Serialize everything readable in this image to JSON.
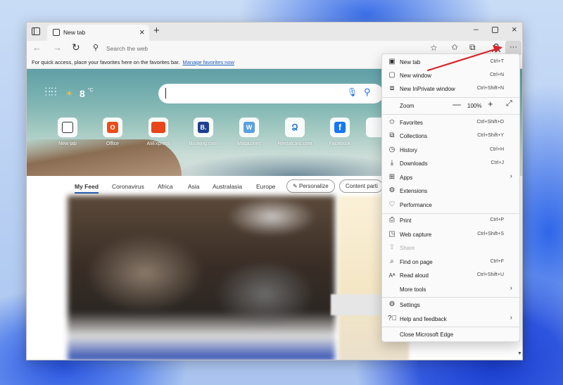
{
  "browser": {
    "tab_title": "New tab",
    "address_placeholder": "Search the web",
    "favorites_bar_message": "For quick access, place your favorites here on the favorites bar.",
    "favorites_bar_link": "Manage favorites now",
    "more_button_label": "···"
  },
  "ntp": {
    "weather_temp": "8",
    "weather_unit": "°C",
    "quick_links": [
      {
        "label": "New tab",
        "color": "#ffffff"
      },
      {
        "label": "Office",
        "color": "#e84e1b"
      },
      {
        "label": "AliExpress",
        "color": "#e8451a"
      },
      {
        "label": "Booking.com",
        "color": "#1e3f91"
      },
      {
        "label": "Magazines",
        "color": "#5aa0e0"
      },
      {
        "label": "Rentalcars.com",
        "color": "#1f74d4"
      },
      {
        "label": "Facebook",
        "color": "#1877f2"
      }
    ],
    "feed_tabs": [
      "My Feed",
      "Coronavirus",
      "Africa",
      "Asia",
      "Australasia",
      "Europe"
    ],
    "personalize_label": "Personalize",
    "content_partial_label": "Content parti"
  },
  "menu": {
    "items": [
      {
        "label": "New tab",
        "shortcut": "Ctrl+T",
        "icon": "new-tab-icon"
      },
      {
        "label": "New window",
        "shortcut": "Ctrl+N",
        "icon": "new-window-icon"
      },
      {
        "label": "New InPrivate window",
        "shortcut": "Ctrl+Shift+N",
        "icon": "inprivate-icon"
      },
      {
        "label": "Zoom",
        "value": "100%"
      },
      {
        "label": "Favorites",
        "shortcut": "Ctrl+Shift+O",
        "icon": "favorites-icon"
      },
      {
        "label": "Collections",
        "shortcut": "Ctrl+Shift+Y",
        "icon": "collections-icon"
      },
      {
        "label": "History",
        "shortcut": "Ctrl+H",
        "icon": "history-icon"
      },
      {
        "label": "Downloads",
        "shortcut": "Ctrl+J",
        "icon": "downloads-icon"
      },
      {
        "label": "Apps",
        "shortcut": "",
        "icon": "apps-icon"
      },
      {
        "label": "Extensions",
        "shortcut": "",
        "icon": "extensions-icon"
      },
      {
        "label": "Performance",
        "shortcut": "",
        "icon": "performance-icon"
      },
      {
        "label": "Print",
        "shortcut": "Ctrl+P",
        "icon": "print-icon"
      },
      {
        "label": "Web capture",
        "shortcut": "Ctrl+Shift+S",
        "icon": "web-capture-icon"
      },
      {
        "label": "Share",
        "shortcut": "",
        "icon": "share-icon"
      },
      {
        "label": "Find on page",
        "shortcut": "Ctrl+F",
        "icon": "find-icon"
      },
      {
        "label": "Read aloud",
        "shortcut": "Ctrl+Shift+U",
        "icon": "read-aloud-icon"
      },
      {
        "label": "More tools",
        "shortcut": "",
        "icon": ""
      },
      {
        "label": "Settings",
        "shortcut": "",
        "icon": "settings-icon"
      },
      {
        "label": "Help and feedback",
        "shortcut": "",
        "icon": "help-icon"
      },
      {
        "label": "Close Microsoft Edge",
        "shortcut": "",
        "icon": ""
      }
    ]
  },
  "colors": {
    "accent": "#1a5dbf",
    "annotation_arrow": "#d8262c"
  }
}
